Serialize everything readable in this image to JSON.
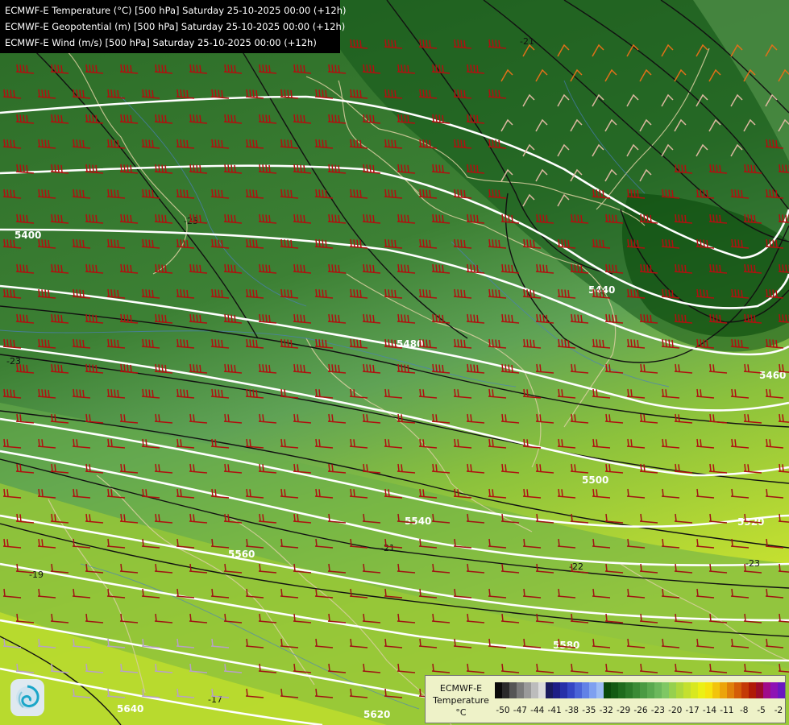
{
  "header": {
    "lines": [
      "ECMWF-E Temperature (°C) [500 hPa] Saturday 25-10-2025 00:00 (+12h)",
      "ECMWF-E Geopotential (m) [500 hPa] Saturday 25-10-2025 00:00 (+12h)",
      "ECMWF-E Wind (m/s) [500 hPa] Saturday 25-10-2025 00:00 (+12h)"
    ]
  },
  "geopotential_labels": [
    "5400",
    "5440",
    "5480",
    "5460",
    "5500",
    "5520",
    "5540",
    "5560",
    "5580",
    "5620",
    "5640"
  ],
  "temperature_labels": [
    "-21",
    "-25",
    "-23",
    "-19",
    "-17",
    "-22",
    "-23",
    "-21"
  ],
  "legend": {
    "title_line1": "ECMWF-E",
    "title_line2": "Temperature",
    "unit": "°C",
    "ticks": [
      "-50",
      "-47",
      "-44",
      "-41",
      "-38",
      "-35",
      "-32",
      "-29",
      "-26",
      "-23",
      "-20",
      "-17",
      "-14",
      "-11",
      "-8",
      "-5",
      "-2"
    ],
    "colors": [
      "#0a0a0a",
      "#2a2a2a",
      "#555555",
      "#7a7a7a",
      "#9a9a9a",
      "#bcbcbc",
      "#dcdcdc",
      "#1a1a5e",
      "#1e1e86",
      "#2630a8",
      "#3446c4",
      "#4a64d8",
      "#6282e6",
      "#7ea0f0",
      "#9cbcf4",
      "#0a4a0a",
      "#135a12",
      "#1e6b1c",
      "#2b7a28",
      "#3a8a35",
      "#4a9a42",
      "#5aa94f",
      "#6cb85c",
      "#7fc764",
      "#96d04e",
      "#aed83c",
      "#c4e02e",
      "#d8e820",
      "#ecf014",
      "#f6e40e",
      "#f2c40c",
      "#eca40a",
      "#e0800a",
      "#d45c08",
      "#c43a06",
      "#b01a06",
      "#9c0c2a",
      "#a00c8a",
      "#8e12b4",
      "#6a18c0"
    ]
  },
  "logo": {
    "icon": "ecmwf-logo"
  }
}
